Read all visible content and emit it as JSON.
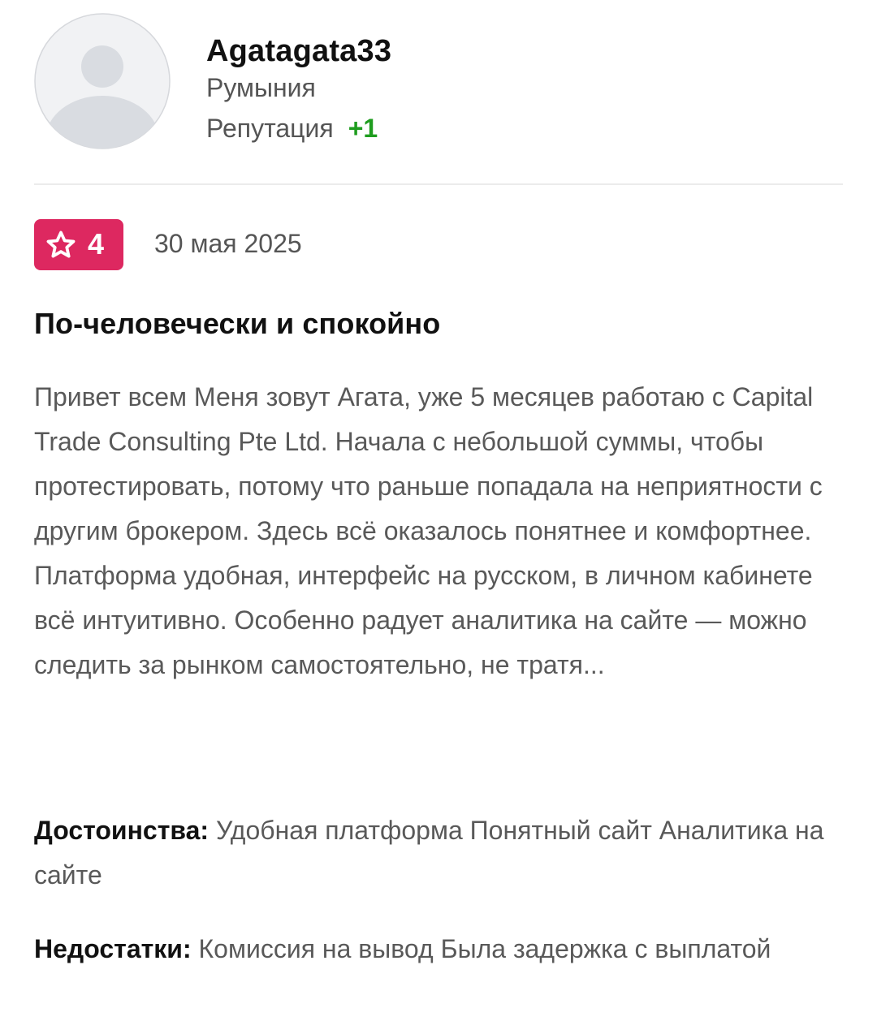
{
  "author": {
    "name": "Agatagata33",
    "country": "Румыния",
    "reputation_label": "Репутация",
    "reputation_value": "+1",
    "avatar_icon": "user-placeholder-icon"
  },
  "rating": {
    "value": "4",
    "icon": "star-icon",
    "color": "#dd2860"
  },
  "date": "30 мая 2025",
  "title": "По-человечески и спокойно",
  "body": "Привет всем Меня зовут Агата, уже 5 месяцев работаю с Capital Trade Consulting Pte Ltd. Начала с небольшой суммы, чтобы протестировать, потому что раньше попадала на неприятности с другим брокером. Здесь всё оказалось понятнее и комфортнее. Платформа удобная, интерфейс на русском, в личном кабинете всё интуитивно. Особенно радует аналитика на сайте — можно следить за рынком самостоятельно, не тратя...",
  "pros": {
    "label": "Достоинства:",
    "text": "Удобная платформа Понятный сайт Аналитика на сайте"
  },
  "cons": {
    "label": "Недостатки:",
    "text": "Комиссия на вывод Была задержка с выплатой"
  },
  "colors": {
    "reputation_positive": "#1f9d1f",
    "badge": "#dd2860",
    "text_secondary": "#595959"
  }
}
